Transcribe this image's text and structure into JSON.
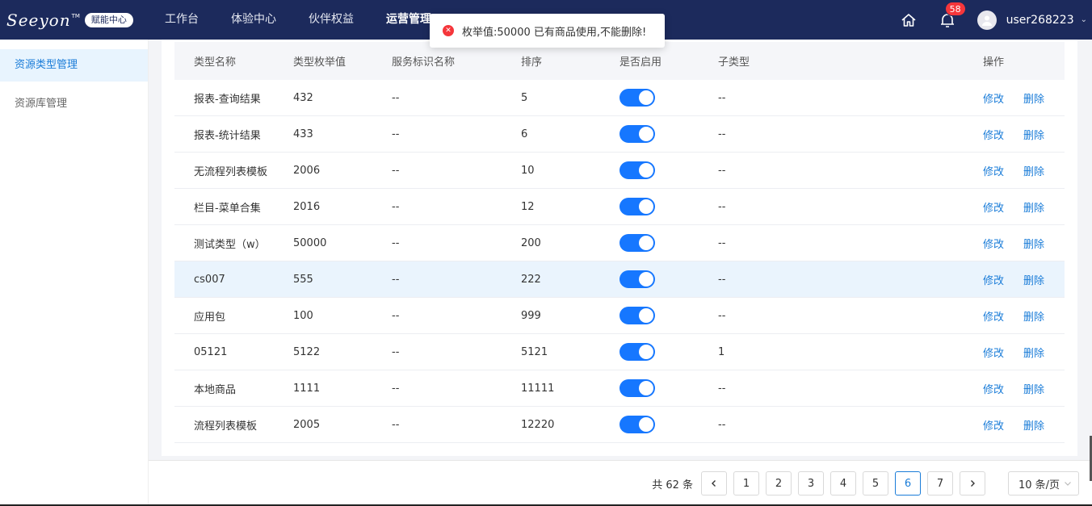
{
  "header": {
    "logo": "Seeyon",
    "logo_tm": "TM",
    "badge": "赋能中心",
    "nav": [
      "工作台",
      "体验中心",
      "伙伴权益",
      "运营管理"
    ],
    "bell_count": "58",
    "username": "user268223"
  },
  "toast": {
    "message": "枚举值:50000 已有商品使用,不能删除!"
  },
  "sidebar": {
    "items": [
      "资源类型管理",
      "资源库管理"
    ]
  },
  "table": {
    "headers": [
      "类型名称",
      "类型枚举值",
      "服务标识名称",
      "排序",
      "是否启用",
      "子类型",
      "操作"
    ],
    "action_edit": "修改",
    "action_delete": "删除",
    "rows": [
      {
        "name": "报表-查询结果",
        "enum": "432",
        "service": "--",
        "order": "5",
        "enabled": true,
        "sub": "--"
      },
      {
        "name": "报表-统计结果",
        "enum": "433",
        "service": "--",
        "order": "6",
        "enabled": true,
        "sub": "--"
      },
      {
        "name": "无流程列表模板",
        "enum": "2006",
        "service": "--",
        "order": "10",
        "enabled": true,
        "sub": "--"
      },
      {
        "name": "栏目-菜单合集",
        "enum": "2016",
        "service": "--",
        "order": "12",
        "enabled": true,
        "sub": "--"
      },
      {
        "name": "测试类型（w）",
        "enum": "50000",
        "service": "--",
        "order": "200",
        "enabled": true,
        "sub": "--"
      },
      {
        "name": "cs007",
        "enum": "555",
        "service": "--",
        "order": "222",
        "enabled": true,
        "sub": "--"
      },
      {
        "name": "应用包",
        "enum": "100",
        "service": "--",
        "order": "999",
        "enabled": true,
        "sub": "--"
      },
      {
        "name": "05121",
        "enum": "5122",
        "service": "--",
        "order": "5121",
        "enabled": true,
        "sub": "1"
      },
      {
        "name": "本地商品",
        "enum": "1111",
        "service": "--",
        "order": "11111",
        "enabled": true,
        "sub": "--"
      },
      {
        "name": "流程列表模板",
        "enum": "2005",
        "service": "--",
        "order": "12220",
        "enabled": true,
        "sub": "--"
      }
    ]
  },
  "pagination": {
    "total": "共 62 条",
    "pages": [
      "1",
      "2",
      "3",
      "4",
      "5",
      "6",
      "7"
    ],
    "current": "6",
    "page_size": "10 条/页"
  }
}
